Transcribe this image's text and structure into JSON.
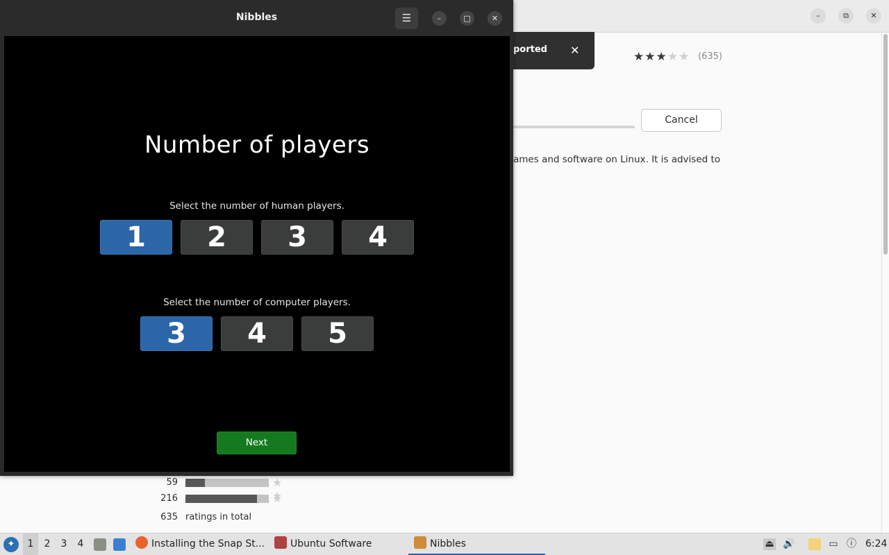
{
  "background_window": {
    "notification": {
      "text": "ported",
      "close_glyph": "✕"
    },
    "rating": {
      "stars": "★★★",
      "stars_empty": "★★",
      "count": "(635)"
    },
    "install_progress": 0.0,
    "cancel_label": "Cancel",
    "description": "ames and software on Linux. It is advised to",
    "histogram": [
      {
        "count": "59",
        "fill": 0.23,
        "stars": "★ ★"
      },
      {
        "count": "216",
        "fill": 0.86,
        "stars": "★"
      }
    ],
    "total": {
      "count": "635",
      "label": "ratings in total"
    },
    "window_controls": {
      "minimize": "–",
      "restore": "⧉",
      "close": "✕"
    }
  },
  "nibbles": {
    "title": "Nibbles",
    "menu_glyph": "☰",
    "window_controls": {
      "minimize": "–",
      "maximize": "□",
      "close": "✕"
    },
    "heading": "Number of players",
    "human_prompt": "Select the number of human players.",
    "human_options": [
      "1",
      "2",
      "3",
      "4"
    ],
    "human_selected": "1",
    "computer_prompt": "Select the number of computer players.",
    "computer_options": [
      "3",
      "4",
      "5"
    ],
    "computer_selected": "3",
    "next_label": "Next"
  },
  "taskbar": {
    "workspaces": [
      "1",
      "2",
      "3",
      "4"
    ],
    "active_workspace": "1",
    "tasks": [
      {
        "label": "Installing the Snap St...",
        "icon": "firefox-icon"
      },
      {
        "label": "Ubuntu Software",
        "icon": "software-icon"
      },
      {
        "label": "Nibbles",
        "icon": "nibbles-icon"
      }
    ],
    "clock": "6:24"
  },
  "colors": {
    "selected_blue": "#2b66a8",
    "next_green": "#14791f",
    "game_bg": "#000000"
  }
}
